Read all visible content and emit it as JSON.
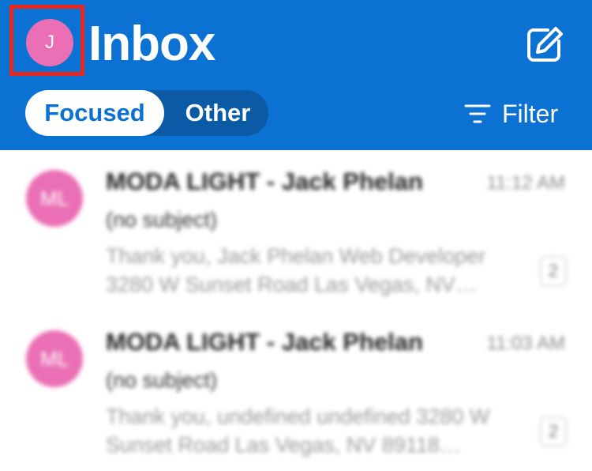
{
  "header": {
    "title": "Inbox",
    "avatar_initial": "J",
    "compose_icon": "compose-icon",
    "accent_color": "#0b72d4"
  },
  "tabs": [
    {
      "label": "Focused",
      "selected": true
    },
    {
      "label": "Other",
      "selected": false
    }
  ],
  "filter": {
    "label": "Filter",
    "icon": "filter-icon"
  },
  "messages": [
    {
      "initials": "ML",
      "sender": "MODA LIGHT - Jack Phelan",
      "time": "11:12 AM",
      "subject": "(no subject)",
      "preview": "Thank you, Jack Phelan Web Developer 3280 W Sunset Road Las Vegas, NV…",
      "thread_count": "2"
    },
    {
      "initials": "ML",
      "sender": "MODA LIGHT - Jack Phelan",
      "time": "11:03 AM",
      "subject": "(no subject)",
      "preview": "Thank you, undefined undefined 3280 W Sunset Road Las Vegas, NV 89118…",
      "thread_count": "2"
    }
  ]
}
